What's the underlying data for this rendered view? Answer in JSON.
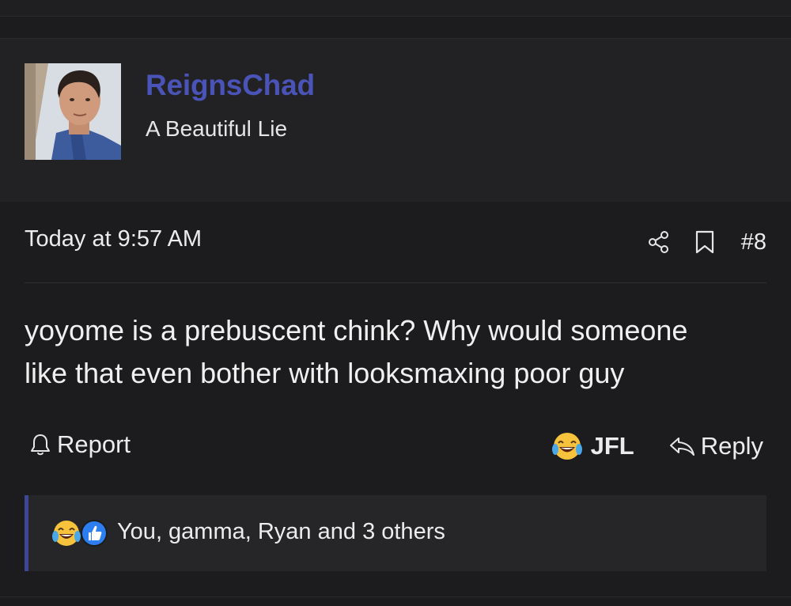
{
  "post": {
    "author": {
      "username": "ReignsChad",
      "user_title": "A Beautiful Lie",
      "avatar_icon": "avatar-photo"
    },
    "timestamp": "Today at 9:57 AM",
    "post_number": "#8",
    "body_line1": "yoyome is a prebuscent chink? Why would someone",
    "body_line2": "like that even bother with looksmaxing poor guy",
    "actions": {
      "report_label": "Report",
      "reaction_label": "JFL",
      "reply_label": "Reply",
      "share_icon": "share-icon",
      "bookmark_icon": "bookmark-icon"
    },
    "reactions": {
      "summary": "You, gamma, Ryan and 3 others",
      "icons": [
        "laugh-cry-emoji-icon",
        "thumbs-up-icon"
      ]
    }
  },
  "colors": {
    "background": "#1c1c1e",
    "header_background": "#222224",
    "username": "#4a54b8",
    "reaction_accent": "#3d4796"
  }
}
